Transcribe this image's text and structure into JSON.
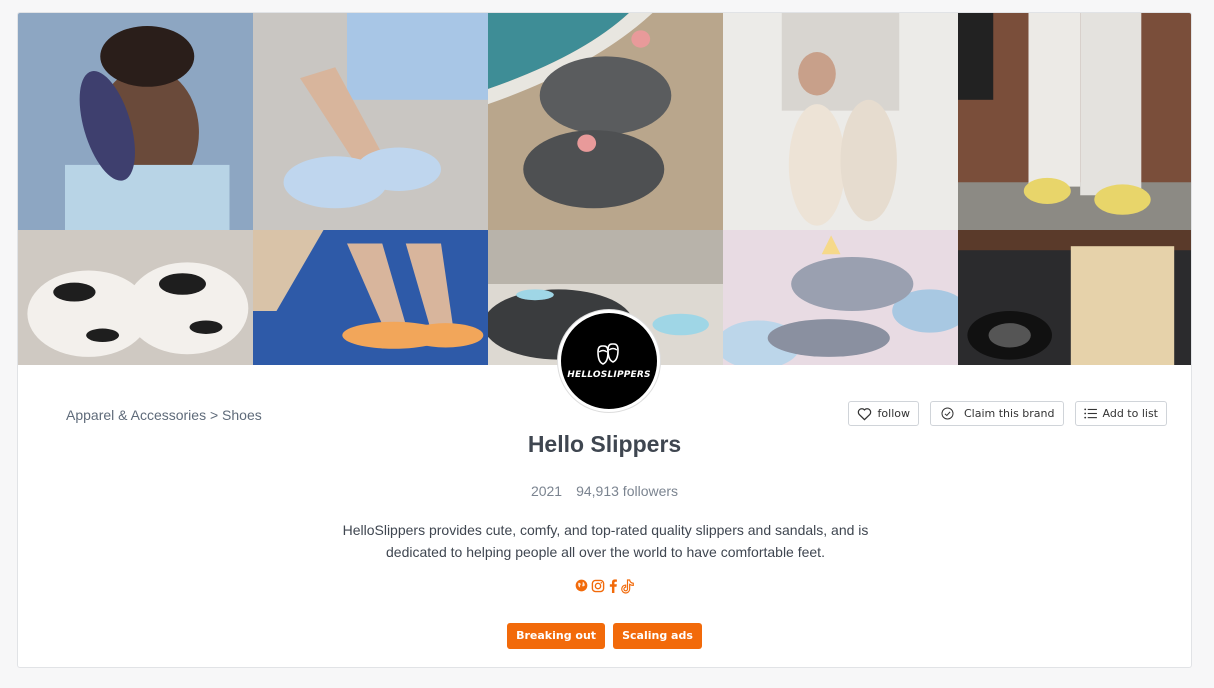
{
  "brand": {
    "name": "Hello Slippers",
    "logo_text": "HELLOSLIPPERS",
    "year": "2021",
    "followers": "94,913 followers",
    "description": "HelloSlippers provides cute, comfy, and top-rated quality slippers and sandals, and is dedicated to helping people all over the world to have comfortable feet."
  },
  "breadcrumb": {
    "category": "Apparel & Accessories",
    "separator": ">",
    "subcategory": "Shoes"
  },
  "actions": {
    "follow": "follow",
    "claim": "Claim this brand",
    "add_to_list": "Add to list"
  },
  "socials": [
    "website-icon",
    "instagram-icon",
    "facebook-icon",
    "tiktok-icon"
  ],
  "tags": [
    "Breaking out",
    "Scaling ads"
  ],
  "colors": {
    "accent": "#f26a0a",
    "title": "#3f4650",
    "muted": "#7b8490"
  },
  "banner_photos": [
    "person-holding-shark-slide",
    "light-blue-slides-on-legs",
    "grey-shark-slides-on-sand",
    "hand-holding-cream-slides",
    "white-pants-smiley-slippers",
    "cow-plush-slippers",
    "orange-slippers-by-pool",
    "shark-slides-dark",
    "unicorn-shark-slides",
    "beige-pants-near-car"
  ]
}
